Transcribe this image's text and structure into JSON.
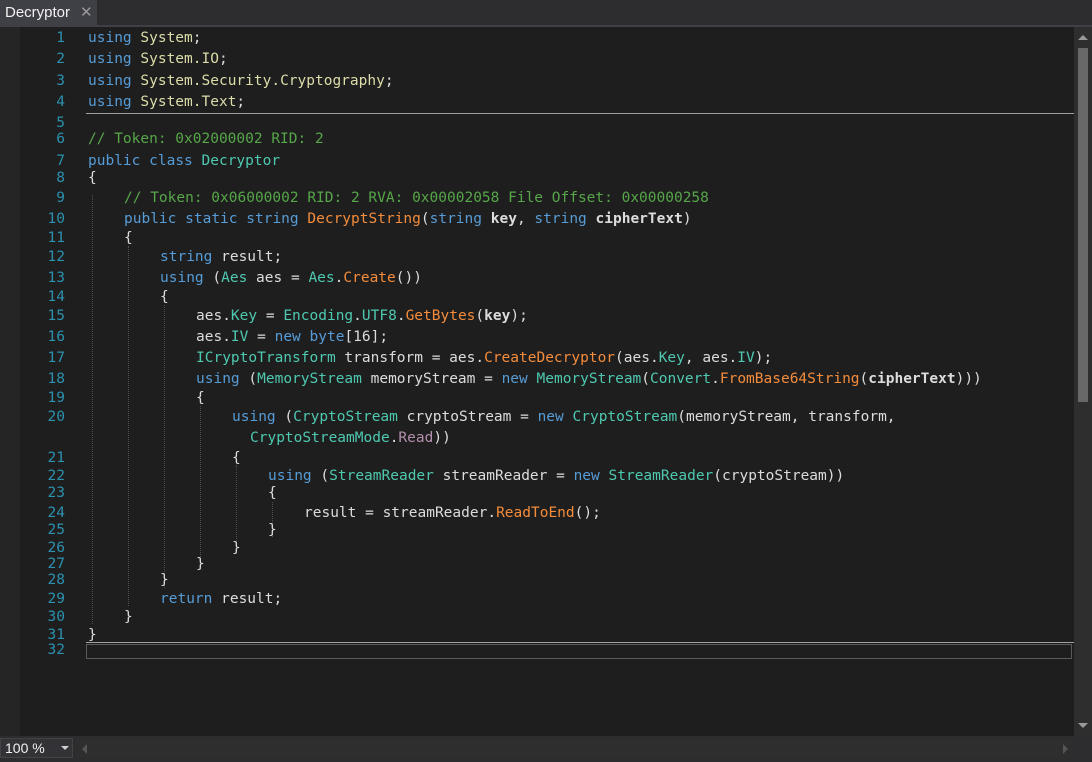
{
  "tab": {
    "title": "Decryptor",
    "close_glyph": "✕"
  },
  "colors": {
    "keyword": "#569cd6",
    "type": "#4ec9b0",
    "namespace": "#dcdcaa",
    "method": "#f48c3b",
    "property": "#4ec9b0",
    "enum_member": "#b48ead",
    "comment": "#57a64a",
    "line_number": "#2b91af",
    "text": "#dcdcdc"
  },
  "code_lines": [
    {
      "num": "1",
      "indent": 0,
      "tokens": [
        [
          "kw",
          "using"
        ],
        [
          "t",
          " "
        ],
        [
          "ns",
          "System"
        ],
        [
          "t",
          ";"
        ]
      ]
    },
    {
      "num": "2",
      "indent": 0,
      "tokens": [
        [
          "kw",
          "using"
        ],
        [
          "t",
          " "
        ],
        [
          "ns",
          "System.IO"
        ],
        [
          "t",
          ";"
        ]
      ]
    },
    {
      "num": "3",
      "indent": 0,
      "tokens": [
        [
          "kw",
          "using"
        ],
        [
          "t",
          " "
        ],
        [
          "ns",
          "System.Security.Cryptography"
        ],
        [
          "t",
          ";"
        ]
      ]
    },
    {
      "num": "4",
      "indent": 0,
      "tokens": [
        [
          "kw",
          "using"
        ],
        [
          "t",
          " "
        ],
        [
          "ns",
          "System.Text"
        ],
        [
          "t",
          ";"
        ]
      ]
    },
    {
      "num": "5",
      "indent": 0,
      "tokens": []
    },
    {
      "num": "6",
      "indent": 0,
      "tokens": [
        [
          "cm",
          "// Token: 0x02000002 RID: 2"
        ]
      ]
    },
    {
      "num": "7",
      "indent": 0,
      "tokens": [
        [
          "kw",
          "public"
        ],
        [
          "t",
          " "
        ],
        [
          "kw",
          "class"
        ],
        [
          "t",
          " "
        ],
        [
          "ty",
          "Decryptor"
        ]
      ]
    },
    {
      "num": "8",
      "indent": 0,
      "tokens": [
        [
          "t",
          "{"
        ]
      ]
    },
    {
      "num": "9",
      "indent": 1,
      "tokens": [
        [
          "cm",
          "// Token: 0x06000002 RID: 2 RVA: 0x00002058 File Offset: 0x00000258"
        ]
      ]
    },
    {
      "num": "10",
      "indent": 1,
      "tokens": [
        [
          "kw",
          "public"
        ],
        [
          "t",
          " "
        ],
        [
          "kw",
          "static"
        ],
        [
          "t",
          " "
        ],
        [
          "kw",
          "string"
        ],
        [
          "t",
          " "
        ],
        [
          "me",
          "DecryptString"
        ],
        [
          "t",
          "("
        ],
        [
          "kw",
          "string"
        ],
        [
          "t",
          " "
        ],
        [
          "b",
          "key"
        ],
        [
          "t",
          ", "
        ],
        [
          "kw",
          "string"
        ],
        [
          "t",
          " "
        ],
        [
          "b",
          "cipherText"
        ],
        [
          "t",
          ")"
        ]
      ]
    },
    {
      "num": "11",
      "indent": 1,
      "tokens": [
        [
          "t",
          "{"
        ]
      ]
    },
    {
      "num": "12",
      "indent": 2,
      "tokens": [
        [
          "kw",
          "string"
        ],
        [
          "t",
          " result;"
        ]
      ]
    },
    {
      "num": "13",
      "indent": 2,
      "tokens": [
        [
          "kw",
          "using"
        ],
        [
          "t",
          " ("
        ],
        [
          "ty",
          "Aes"
        ],
        [
          "t",
          " aes = "
        ],
        [
          "ty",
          "Aes"
        ],
        [
          "t",
          "."
        ],
        [
          "me",
          "Create"
        ],
        [
          "t",
          "())"
        ]
      ]
    },
    {
      "num": "14",
      "indent": 2,
      "tokens": [
        [
          "t",
          "{"
        ]
      ]
    },
    {
      "num": "15",
      "indent": 3,
      "tokens": [
        [
          "t",
          "aes."
        ],
        [
          "pr",
          "Key"
        ],
        [
          "t",
          " = "
        ],
        [
          "ty",
          "Encoding"
        ],
        [
          "t",
          "."
        ],
        [
          "pr",
          "UTF8"
        ],
        [
          "t",
          "."
        ],
        [
          "me",
          "GetBytes"
        ],
        [
          "t",
          "("
        ],
        [
          "b",
          "key"
        ],
        [
          "t",
          ");"
        ]
      ]
    },
    {
      "num": "16",
      "indent": 3,
      "tokens": [
        [
          "t",
          "aes."
        ],
        [
          "pr",
          "IV"
        ],
        [
          "t",
          " = "
        ],
        [
          "kw",
          "new"
        ],
        [
          "t",
          " "
        ],
        [
          "kw",
          "byte"
        ],
        [
          "t",
          "[16];"
        ]
      ]
    },
    {
      "num": "17",
      "indent": 3,
      "tokens": [
        [
          "ty",
          "ICryptoTransform"
        ],
        [
          "t",
          " transform = aes."
        ],
        [
          "me",
          "CreateDecryptor"
        ],
        [
          "t",
          "(aes."
        ],
        [
          "pr",
          "Key"
        ],
        [
          "t",
          ", aes."
        ],
        [
          "pr",
          "IV"
        ],
        [
          "t",
          ");"
        ]
      ]
    },
    {
      "num": "18",
      "indent": 3,
      "tokens": [
        [
          "kw",
          "using"
        ],
        [
          "t",
          " ("
        ],
        [
          "ty",
          "MemoryStream"
        ],
        [
          "t",
          " memoryStream = "
        ],
        [
          "kw",
          "new"
        ],
        [
          "t",
          " "
        ],
        [
          "ty",
          "MemoryStream"
        ],
        [
          "t",
          "("
        ],
        [
          "ty",
          "Convert"
        ],
        [
          "t",
          "."
        ],
        [
          "me",
          "FromBase64String"
        ],
        [
          "t",
          "("
        ],
        [
          "b",
          "cipherText"
        ],
        [
          "t",
          ")))"
        ]
      ]
    },
    {
      "num": "19",
      "indent": 3,
      "tokens": [
        [
          "t",
          "{"
        ]
      ]
    },
    {
      "num": "20",
      "indent": 4,
      "tokens": [
        [
          "kw",
          "using"
        ],
        [
          "t",
          " ("
        ],
        [
          "ty",
          "CryptoStream"
        ],
        [
          "t",
          " cryptoStream = "
        ],
        [
          "kw",
          "new"
        ],
        [
          "t",
          " "
        ],
        [
          "ty",
          "CryptoStream"
        ],
        [
          "t",
          "(memoryStream, transform,"
        ]
      ]
    },
    {
      "num": "",
      "indent": 4,
      "extra": 2,
      "tokens": [
        [
          "ty",
          "CryptoStreamMode"
        ],
        [
          "t",
          "."
        ],
        [
          "en",
          "Read"
        ],
        [
          "t",
          "))"
        ]
      ]
    },
    {
      "num": "21",
      "indent": 4,
      "tokens": [
        [
          "t",
          "{"
        ]
      ]
    },
    {
      "num": "22",
      "indent": 5,
      "tokens": [
        [
          "kw",
          "using"
        ],
        [
          "t",
          " ("
        ],
        [
          "ty",
          "StreamReader"
        ],
        [
          "t",
          " streamReader = "
        ],
        [
          "kw",
          "new"
        ],
        [
          "t",
          " "
        ],
        [
          "ty",
          "StreamReader"
        ],
        [
          "t",
          "(cryptoStream))"
        ]
      ]
    },
    {
      "num": "23",
      "indent": 5,
      "tokens": [
        [
          "t",
          "{"
        ]
      ]
    },
    {
      "num": "24",
      "indent": 6,
      "tokens": [
        [
          "t",
          "result = streamReader."
        ],
        [
          "me",
          "ReadToEnd"
        ],
        [
          "t",
          "();"
        ]
      ]
    },
    {
      "num": "25",
      "indent": 5,
      "tokens": [
        [
          "t",
          "}"
        ]
      ]
    },
    {
      "num": "26",
      "indent": 4,
      "tokens": [
        [
          "t",
          "}"
        ]
      ]
    },
    {
      "num": "27",
      "indent": 3,
      "tokens": [
        [
          "t",
          "}"
        ]
      ]
    },
    {
      "num": "28",
      "indent": 2,
      "tokens": [
        [
          "t",
          "}"
        ]
      ]
    },
    {
      "num": "29",
      "indent": 2,
      "tokens": [
        [
          "kw",
          "return"
        ],
        [
          "t",
          " result;"
        ]
      ]
    },
    {
      "num": "30",
      "indent": 1,
      "tokens": [
        [
          "t",
          "}"
        ]
      ]
    },
    {
      "num": "31",
      "indent": 0,
      "tokens": [
        [
          "t",
          "}"
        ]
      ]
    },
    {
      "num": "32",
      "indent": 0,
      "tokens": []
    }
  ],
  "status": {
    "zoom": "100 %"
  }
}
